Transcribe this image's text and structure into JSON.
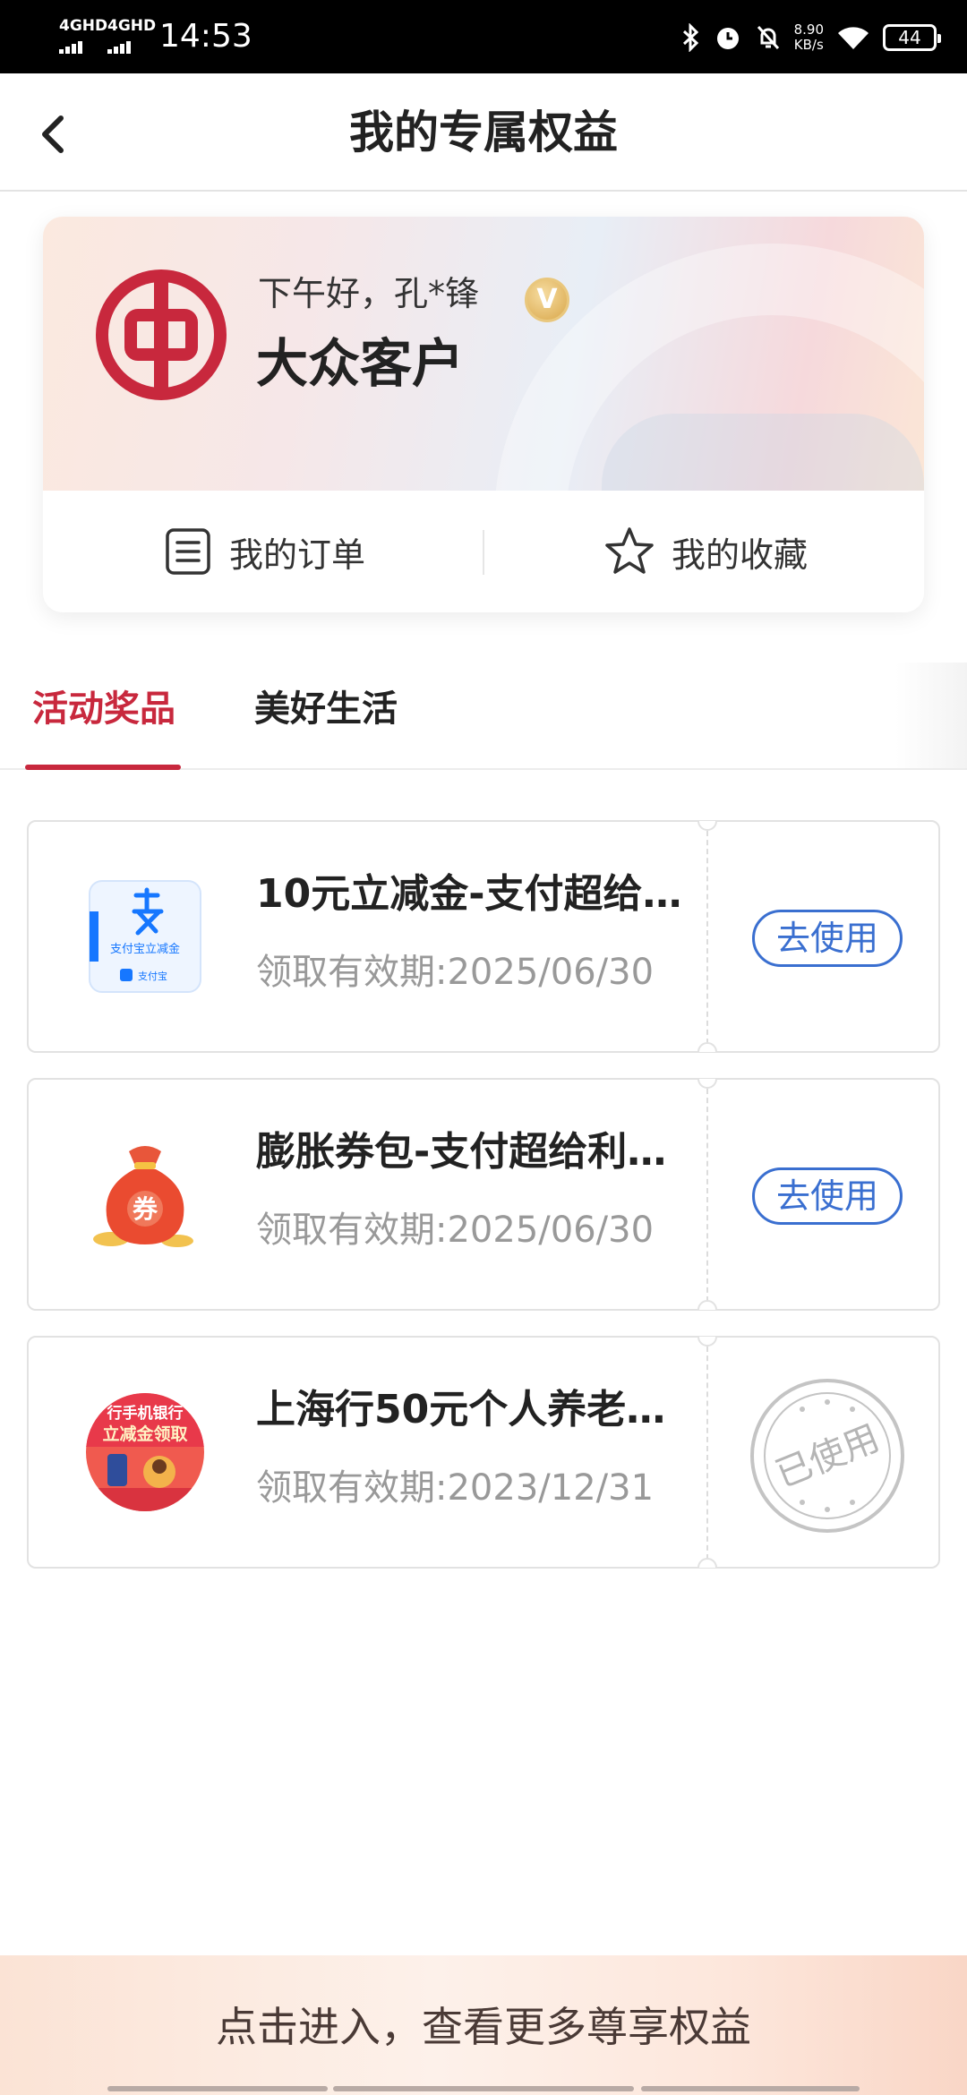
{
  "status_bar": {
    "network_1": "4GHD",
    "network_2": "4GHD",
    "time": "14:53",
    "speed_value": "8.90",
    "speed_unit": "KB/s",
    "battery": "44"
  },
  "header": {
    "title": "我的专属权益",
    "back_icon": "chevron-left-icon"
  },
  "profile": {
    "greeting": "下午好，孔*锋",
    "badge_letter": "V",
    "tier": "大众客户",
    "logo_color": "#c8283d",
    "actions": [
      {
        "label": "我的订单",
        "icon": "order-list-icon"
      },
      {
        "label": "我的收藏",
        "icon": "star-icon"
      }
    ]
  },
  "tabs": [
    {
      "label": "活动奖品",
      "active": true
    },
    {
      "label": "美好生活",
      "active": false
    }
  ],
  "rewards": [
    {
      "title": "10元立减金-支付超给…",
      "validity": "领取有效期:2025/06/30",
      "action": "去使用",
      "thumb_icon": "alipay-coupon-icon",
      "thumb_text_1": "支付宝立减金",
      "thumb_text_2": "支付宝",
      "state": "available"
    },
    {
      "title": "膨胀券包-支付超给利…",
      "validity": "领取有效期:2025/06/30",
      "action": "去使用",
      "thumb_icon": "coupon-bag-icon",
      "thumb_text_1": "券",
      "state": "available"
    },
    {
      "title": "上海行50元个人养老…",
      "validity": "领取有效期:2023/12/31",
      "action": "已使用",
      "thumb_icon": "pension-promo-icon",
      "thumb_text_1": "行手机银行",
      "thumb_text_2": "立减金领取",
      "state": "used"
    }
  ],
  "bottom_banner": {
    "text": "点击进入，查看更多尊享权益"
  },
  "colors": {
    "accent_red": "#c8283d",
    "link_blue": "#3a6fd0",
    "muted_text": "#999999"
  }
}
